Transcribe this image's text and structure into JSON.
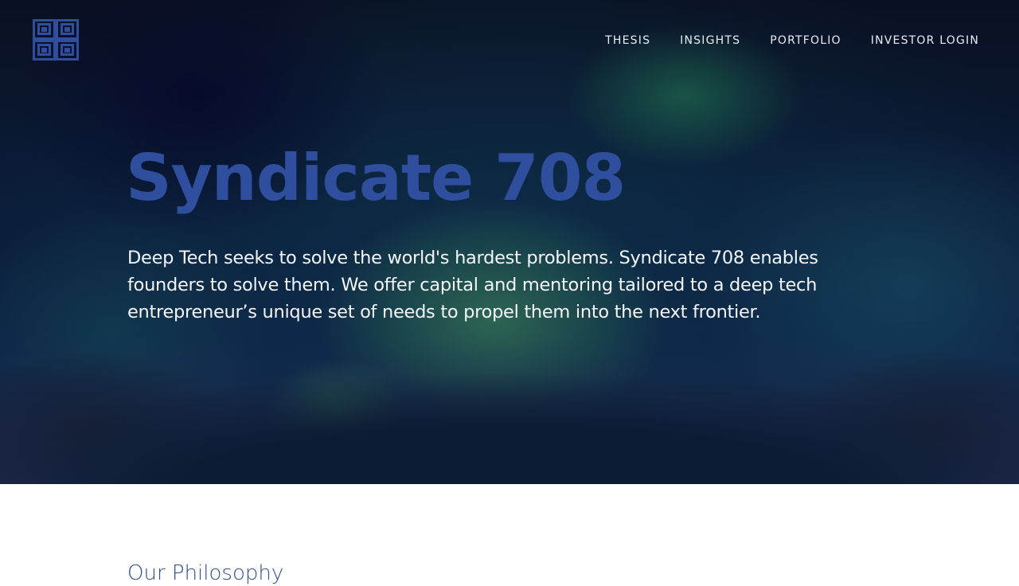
{
  "brand": {
    "logo_icon": "interlocking-squares-logo-icon",
    "accent_color": "#2f4f9e"
  },
  "nav": {
    "items": [
      {
        "label": "THESIS"
      },
      {
        "label": "INSIGHTS"
      },
      {
        "label": "PORTFOLIO"
      },
      {
        "label": "INVESTOR LOGIN"
      }
    ]
  },
  "hero": {
    "title": "Syndicate 708",
    "tagline": "Deep Tech seeks to solve the world's hardest problems. Syndicate 708 enables founders to solve them. We offer capital and mentoring tailored to a deep tech entrepreneur’s unique set of needs to propel them into the next frontier."
  },
  "philosophy": {
    "heading": "Our Philosophy"
  }
}
